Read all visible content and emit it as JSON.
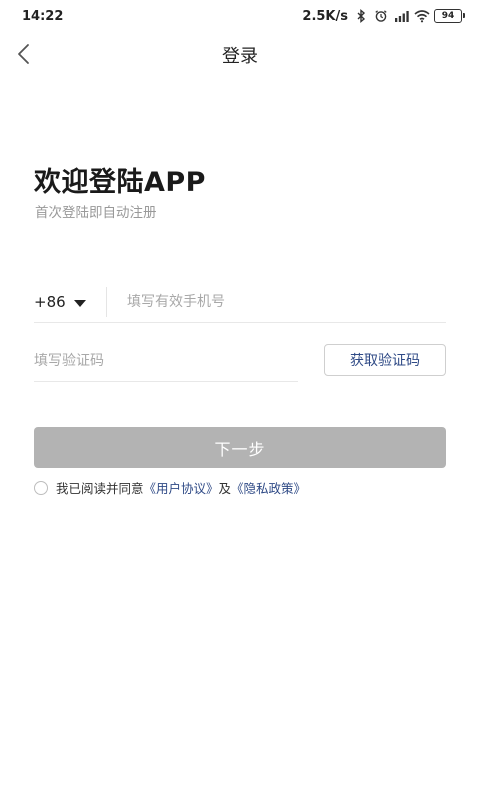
{
  "status_bar": {
    "time": "14:22",
    "network_speed": "2.5K/s",
    "battery_level": "94",
    "icons": [
      "bluetooth-icon",
      "alarm-icon",
      "signal-icon",
      "wifi-icon",
      "battery-icon"
    ]
  },
  "nav": {
    "title": "登录",
    "back_icon": "chevron-left-icon"
  },
  "welcome": {
    "title": "欢迎登陆APP",
    "subtitle": "首次登陆即自动注册"
  },
  "phone": {
    "country_code": "+86",
    "placeholder": "填写有效手机号",
    "value": ""
  },
  "code": {
    "placeholder": "填写验证码",
    "value": "",
    "get_code_label": "获取验证码"
  },
  "next_button": {
    "label": "下一步"
  },
  "agreement": {
    "prefix": "我已阅读并同意",
    "user_agreement": "《用户协议》",
    "and": "及",
    "privacy_policy": "《隐私政策》"
  },
  "colors": {
    "background": "#ffffff",
    "link": "#2f4a86",
    "button_disabled": "#b3b3b3",
    "placeholder": "#a8a8a8",
    "subtitle": "#999999",
    "divider": "#e8e8e8"
  }
}
